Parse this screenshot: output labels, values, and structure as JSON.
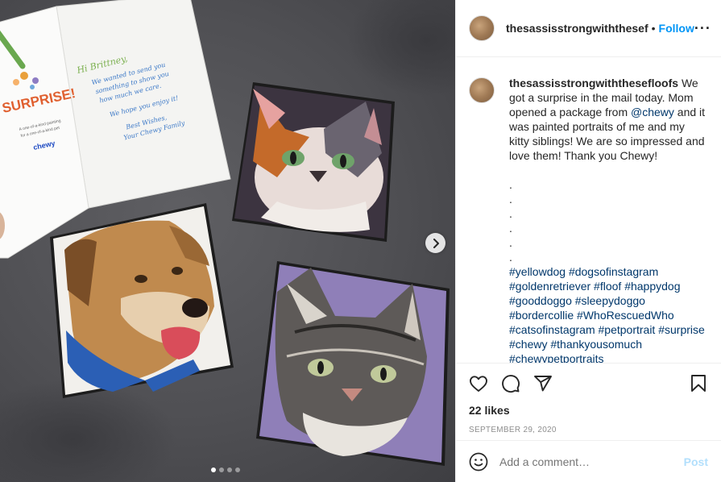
{
  "photo": {
    "card": {
      "surprise": "SURPRISE!",
      "tagline_1": "A one-of-a-kind painting",
      "tagline_2": "for a one-of-a-kind pet",
      "brand": "chewy",
      "greeting": "Hi Brittney,",
      "line_1": "We wanted to send you",
      "line_2": "something to show you",
      "line_3": "how much we care.",
      "line_4": "We hope you enjoy it!",
      "line_5": "Best Wishes,",
      "line_6": "Your Chewy Family"
    },
    "carousel": {
      "dots": 4,
      "active_dot": 1
    }
  },
  "header": {
    "username": "thesassisstrongwiththesef",
    "separator": "•",
    "follow_label": "Follow",
    "more_label": "···"
  },
  "caption": {
    "username": "thesassisstrongwiththesefloofs",
    "text_1": "We got a surprise in the mail today. Mom opened a package from ",
    "mention": "@chewy",
    "text_2": " and it was painted portraits of me and my kitty siblings! We are so impressed and love them! Thank you Chewy!",
    "dots": [
      ".",
      ".",
      ".",
      ".",
      ".",
      "."
    ],
    "hashtags": "#yellowdog #dogsofinstagram #goldenretriever #floof #happydog #gooddoggo #sleepydoggo #bordercollie #WhoRescuedWho #catsofinstagram #petportrait #surprise #chewy #thankyousomuch #chewypetportraits"
  },
  "actions": {
    "like_icon": "heart-icon",
    "comment_icon": "comment-icon",
    "share_icon": "share-icon",
    "save_icon": "bookmark-icon",
    "likes": "22 likes",
    "date": "SEPTEMBER 29, 2020"
  },
  "add_comment": {
    "emoji_icon": "smiley-icon",
    "placeholder": "Add a comment…",
    "post_label": "Post"
  },
  "colors": {
    "follow": "#0095f6",
    "link": "#00376b",
    "post_disabled": "#b2dffc",
    "muted": "#8e8e8e"
  }
}
